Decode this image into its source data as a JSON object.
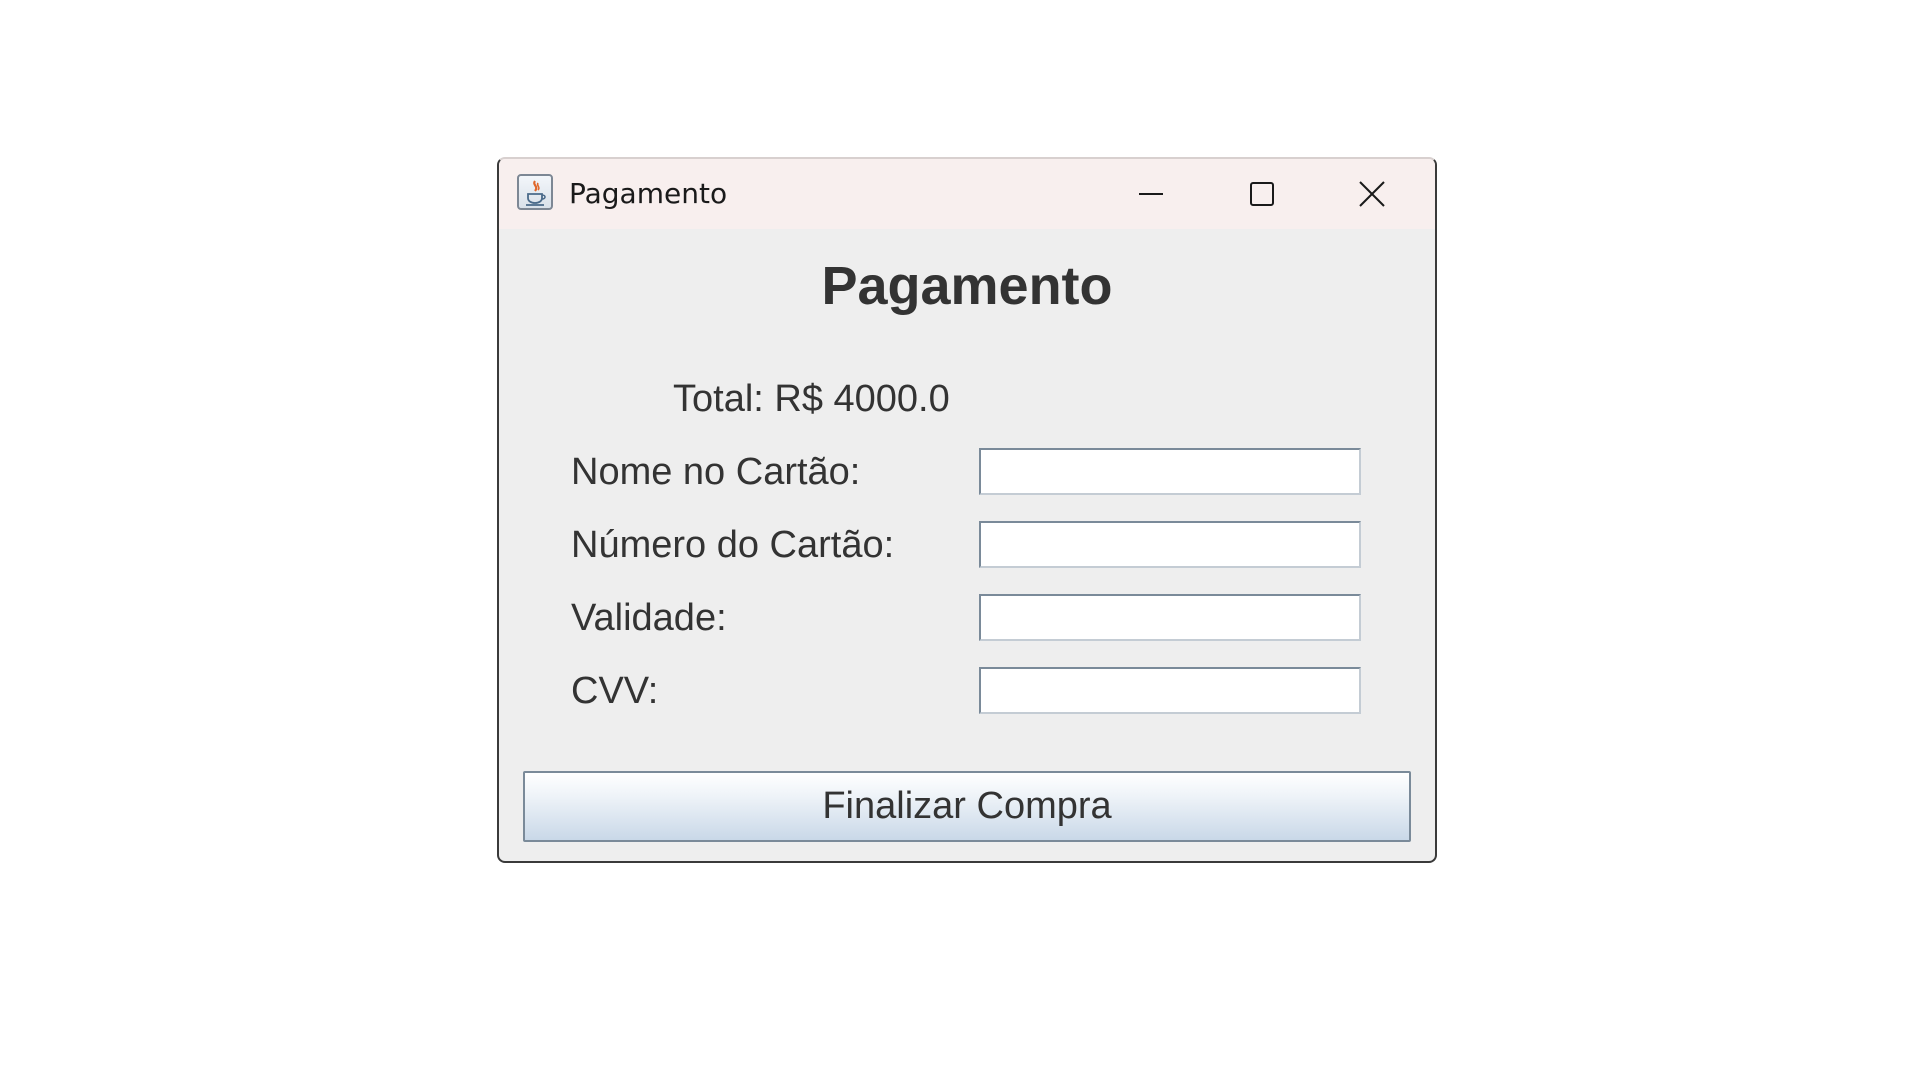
{
  "window": {
    "title": "Pagamento",
    "icon": "java-cup-icon",
    "controls": {
      "minimize": "minimize-icon",
      "maximize": "maximize-icon",
      "close": "close-icon"
    }
  },
  "form": {
    "heading": "Pagamento",
    "total": "Total: R$ 4000.0",
    "fields": [
      {
        "label": "Nome no Cartão:",
        "value": "",
        "placeholder": ""
      },
      {
        "label": "Número do Cartão:",
        "value": "",
        "placeholder": ""
      },
      {
        "label": "Validade:",
        "value": "",
        "placeholder": ""
      },
      {
        "label": "CVV:",
        "value": "",
        "placeholder": ""
      }
    ],
    "submit_label": "Finalizar Compra"
  },
  "colors": {
    "titlebar_bg": "#f8efee",
    "panel_bg": "#eeeeee",
    "text": "#333333",
    "button_gradient_bottom": "#c9d8e8"
  }
}
